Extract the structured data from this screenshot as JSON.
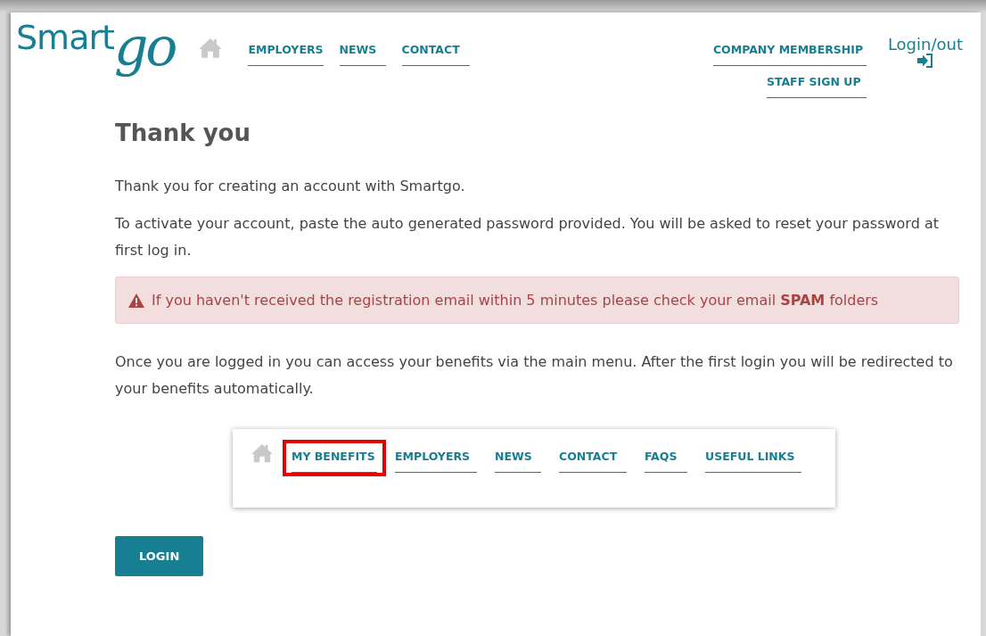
{
  "logo": {
    "first": "Smart",
    "second": "go"
  },
  "nav": [
    {
      "label": "EMPLOYERS"
    },
    {
      "label": "NEWS"
    },
    {
      "label": "CONTACT"
    }
  ],
  "account_links": [
    {
      "label": "COMPANY MEMBERSHIP"
    },
    {
      "label": "STAFF SIGN UP"
    }
  ],
  "login_out": "Login/out",
  "heading": "Thank you",
  "paragraphs_top": [
    "Thank you for creating an account with Smartgo.",
    "To activate your account, paste the auto generated password provided. You will be asked to reset your password at first log in."
  ],
  "alert": "If you haven't received the registration email within 5 minutes please check your email **SPAM** folders",
  "paragraph_bottom": "Once you are logged in you can access your benefits via the main menu. After the first login you will be redirected to your benefits automatically.",
  "menu_example": [
    {
      "label": "MY BENEFITS",
      "highlighted": true
    },
    {
      "label": "EMPLOYERS",
      "highlighted": false
    },
    {
      "label": "NEWS",
      "highlighted": false
    },
    {
      "label": "CONTACT",
      "highlighted": false
    },
    {
      "label": "FAQS",
      "highlighted": false
    },
    {
      "label": "USEFUL LINKS",
      "highlighted": false
    }
  ],
  "button": "LOGIN"
}
